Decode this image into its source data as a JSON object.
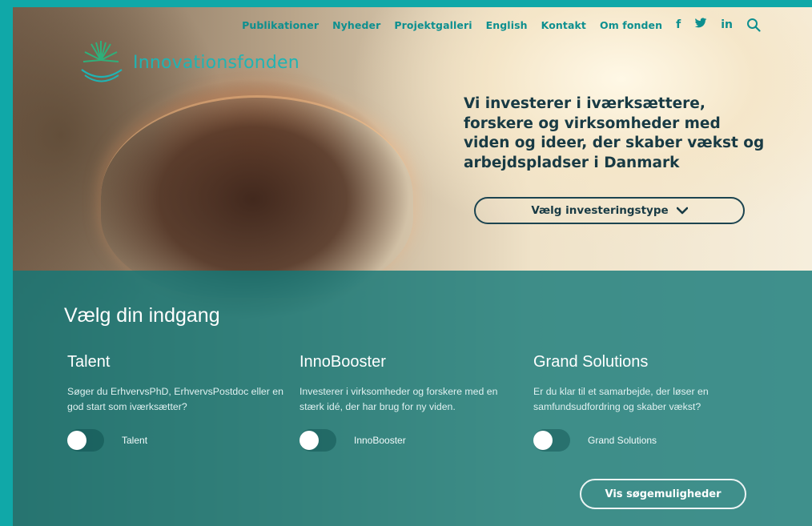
{
  "nav": {
    "items": [
      "Publikationer",
      "Nyheder",
      "Projektgalleri",
      "English",
      "Kontakt",
      "Om fonden"
    ],
    "social": [
      "f",
      "y",
      "in"
    ],
    "icons": [
      "facebook-icon",
      "twitter-icon",
      "linkedin-icon",
      "search-icon"
    ]
  },
  "logo": {
    "text": "Innovationsfonden"
  },
  "hero": {
    "headline": "Vi investerer i iværksættere, forskere og virksomheder med viden og ideer, der skaber vækst og arbejdspladser i Danmark",
    "select_label": "Vælg investeringstype"
  },
  "panel": {
    "title": "Vælg din indgang",
    "columns": [
      {
        "title": "Talent",
        "text": "Søger du ErhvervsPhD, ErhvervsPostdoc eller en god start som iværksætter?",
        "toggle_label": "Talent"
      },
      {
        "title": "InnoBooster",
        "text": "Investerer i virksomheder og forskere med en stærk idé, der har brug for ny viden.",
        "toggle_label": "InnoBooster"
      },
      {
        "title": "Grand Solutions",
        "text": "Er du klar til et samarbejde, der løser en samfundsudfordring og skaber vækst?",
        "toggle_label": "Grand Solutions"
      }
    ],
    "search_button": "Vis søgemuligheder"
  },
  "colors": {
    "accent": "#0d8f8f",
    "panel": "#127878",
    "page_bg": "#10a8a8"
  }
}
